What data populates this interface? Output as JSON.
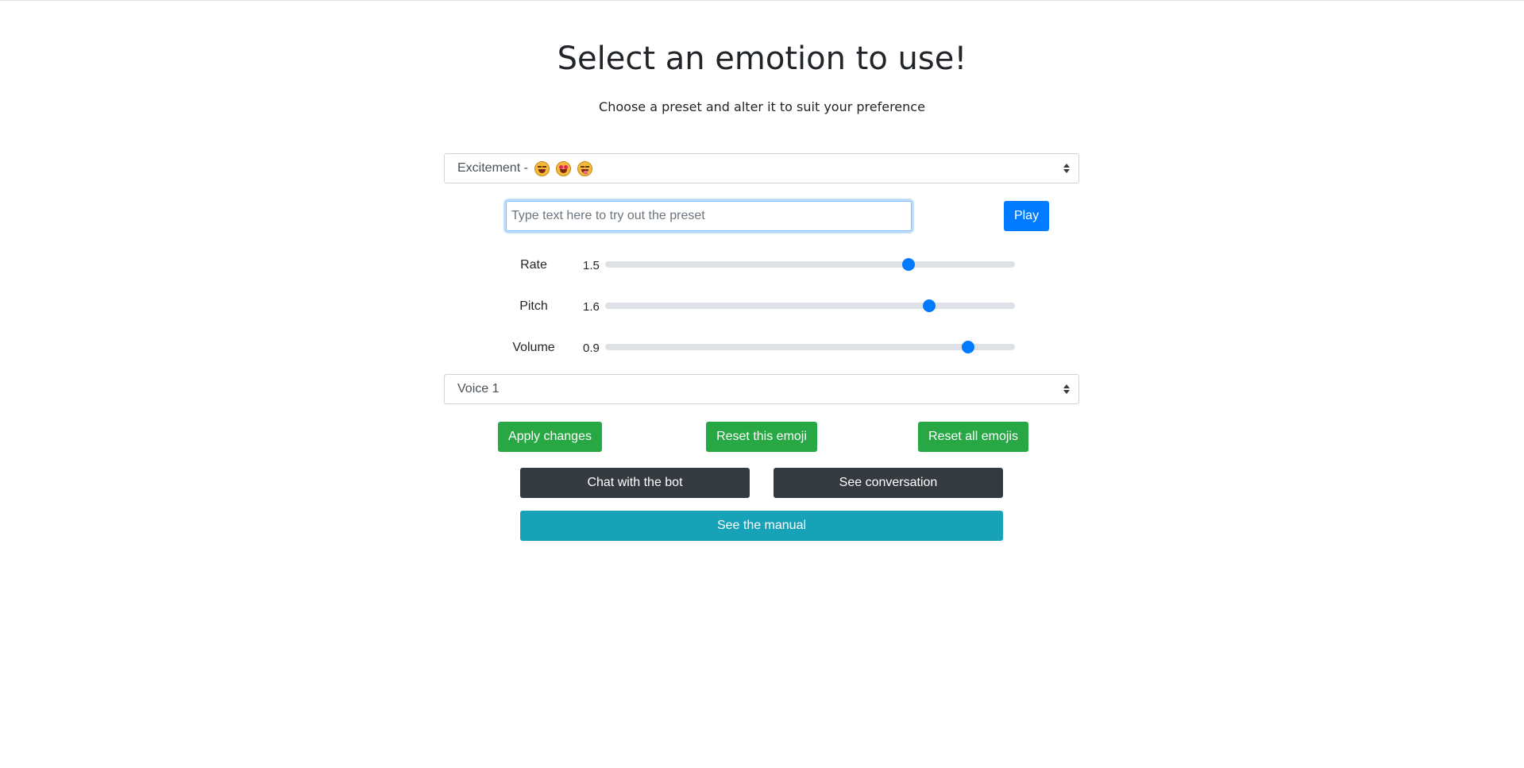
{
  "header": {
    "title": "Select an emotion to use!",
    "subtitle": "Choose a preset and alter it to suit your preference"
  },
  "preset_select": {
    "selected": "Excitement -",
    "emoji_icons": [
      "grinning-squinting-face-icon",
      "star-struck-face-icon",
      "squinting-tongue-face-icon"
    ]
  },
  "try_input": {
    "value": "",
    "placeholder": "Type text here to try out the preset"
  },
  "play_button": {
    "label": "Play"
  },
  "sliders": [
    {
      "label": "Rate",
      "value": "1.5",
      "fraction": 0.74
    },
    {
      "label": "Pitch",
      "value": "1.6",
      "fraction": 0.79
    },
    {
      "label": "Volume",
      "value": "0.9",
      "fraction": 0.885
    }
  ],
  "voice_select": {
    "selected": "Voice 1"
  },
  "actions": {
    "apply": "Apply changes",
    "reset_one": "Reset this emoji",
    "reset_all": "Reset all emojis"
  },
  "nav": {
    "chat": "Chat with the bot",
    "conversation": "See conversation",
    "manual": "See the manual"
  },
  "colors": {
    "primary": "#007bff",
    "success": "#28a745",
    "dark": "#343a40",
    "info": "#17a2b8"
  }
}
